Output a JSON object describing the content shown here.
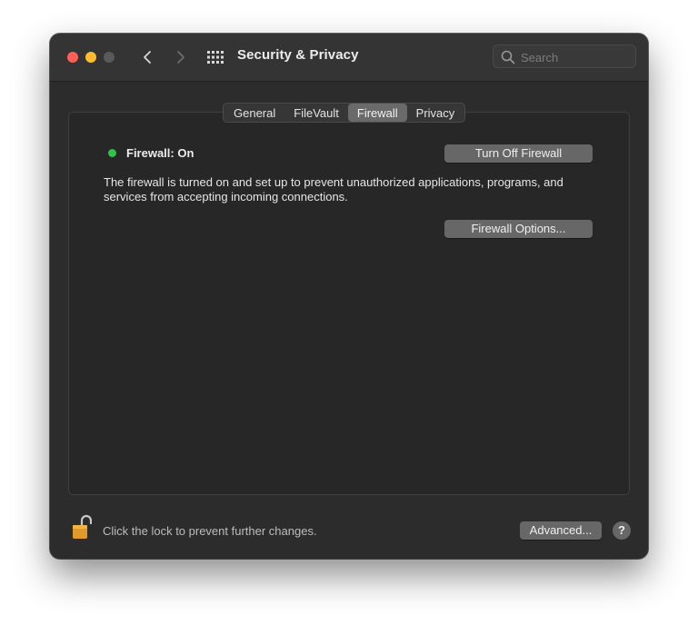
{
  "window": {
    "title": "Security & Privacy",
    "search": {
      "placeholder": "Search",
      "value": ""
    }
  },
  "tabs": [
    {
      "label": "General",
      "active": false
    },
    {
      "label": "FileVault",
      "active": false
    },
    {
      "label": "Firewall",
      "active": true
    },
    {
      "label": "Privacy",
      "active": false
    }
  ],
  "firewall": {
    "status_label": "Firewall: On",
    "status_color": "#2fc34a",
    "toggle_button": "Turn Off Firewall",
    "description": "The firewall is turned on and set up to prevent unauthorized applications, programs, and services from accepting incoming connections.",
    "options_button": "Firewall Options..."
  },
  "footer": {
    "lock_text": "Click the lock to prevent further changes.",
    "advanced_button": "Advanced...",
    "help_label": "?"
  },
  "icons": [
    "close-button",
    "minimize-button",
    "zoom-button",
    "back-chevron-icon",
    "forward-chevron-icon",
    "grid-icon",
    "search-icon",
    "unlocked-lock-icon"
  ]
}
